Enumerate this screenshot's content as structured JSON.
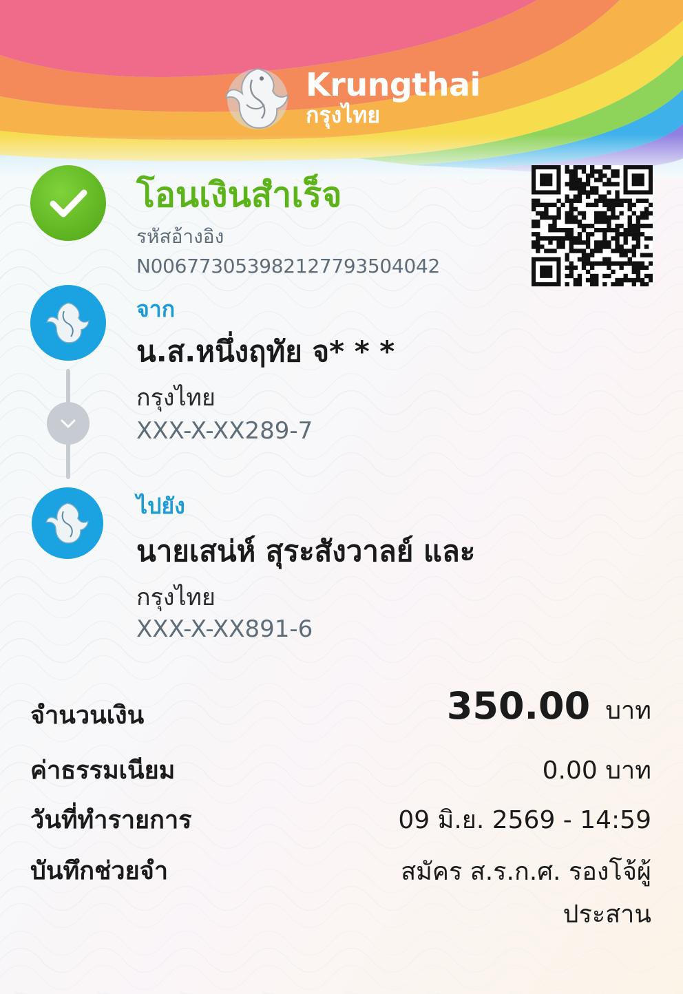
{
  "brand": {
    "name_en": "Krungthai",
    "name_th": "กรุงไทย"
  },
  "status": {
    "title": "โอนเงินสำเร็จ",
    "icon": "check-icon",
    "color": "#5db41a"
  },
  "reference": {
    "label": "รหัสอ้างอิง",
    "value": "N006773053982127793504042"
  },
  "qr": {
    "icon": "qr-code-icon"
  },
  "from": {
    "label": "จาก",
    "name": "น.ส.หนึ่งฤทัย จ* * *",
    "bank": "กรุงไทย",
    "account": "XXX-X-XX289-7"
  },
  "to": {
    "label": "ไปยัง",
    "name": "นายเสน่ห์ สุระสังวาลย์ และ",
    "bank": "กรุงไทย",
    "account": "XXX-X-XX891-6"
  },
  "details": {
    "amount_label": "จำนวนเงิน",
    "amount_value": "350.00",
    "amount_currency": "บาท",
    "fee_label": "ค่าธรรมเนียม",
    "fee_value": "0.00 บาท",
    "date_label": "วันที่ทำรายการ",
    "date_value": "09 มิ.ย. 2569 - 14:59",
    "memo_label": "บันทึกช่วยจำ",
    "memo_value": "สมัคร ส.ร.ก.ศ. รองโจ้ผู้ประสาน"
  },
  "colors": {
    "accent_blue": "#1b9bd7",
    "success_green": "#5db41a",
    "muted_text": "#5f6d7a"
  }
}
